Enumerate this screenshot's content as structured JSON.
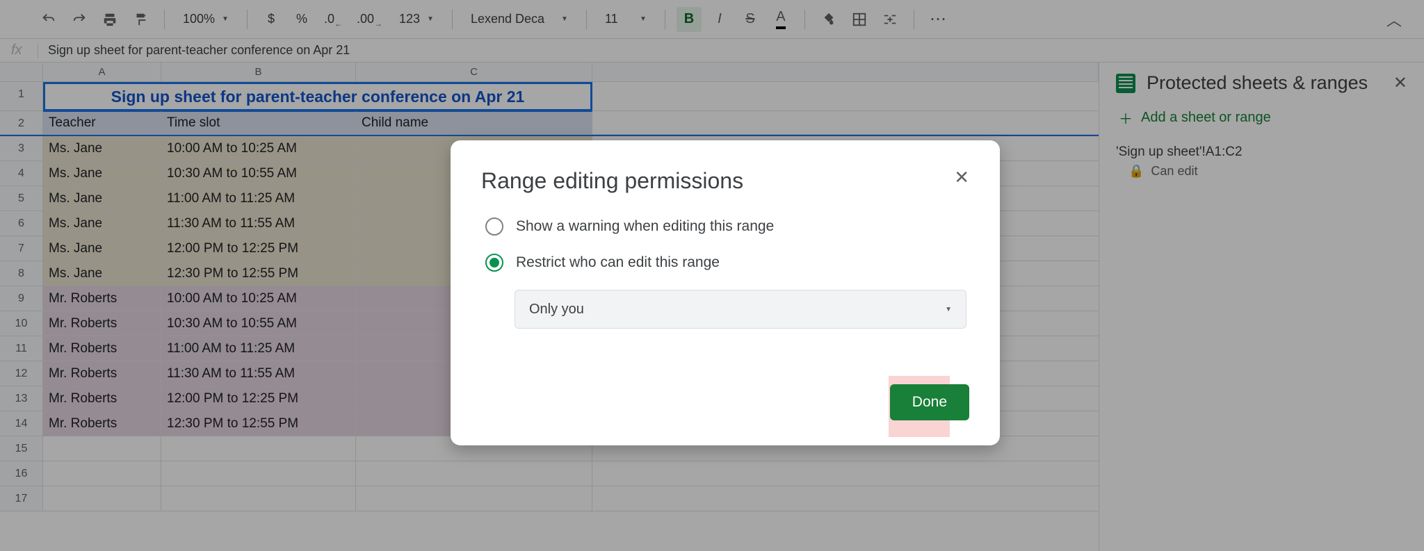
{
  "toolbar": {
    "zoom": "100%",
    "currency": "$",
    "percent": "%",
    "dec_dec": ".0",
    "dec_inc": ".00",
    "fmt123": "123",
    "font": "Lexend Deca",
    "font_size": "11",
    "bold": "B",
    "italic": "I",
    "strike": "S",
    "textcolor": "A",
    "more": "⋯"
  },
  "formula": {
    "label": "fx",
    "value": "Sign up sheet for parent-teacher conference on Apr 21"
  },
  "cols": [
    "A",
    "B",
    "C"
  ],
  "rows": {
    "title": "Sign up sheet for parent-teacher conference on Apr 21",
    "headers": {
      "a": "Teacher",
      "b": "Time slot",
      "c": "Child name"
    },
    "data": [
      {
        "n": "3",
        "a": "Ms. Jane",
        "b": "10:00 AM to 10:25 AM",
        "cls": "jane"
      },
      {
        "n": "4",
        "a": "Ms. Jane",
        "b": "10:30 AM to 10:55 AM",
        "cls": "jane"
      },
      {
        "n": "5",
        "a": "Ms. Jane",
        "b": "11:00 AM to 11:25 AM",
        "cls": "jane"
      },
      {
        "n": "6",
        "a": "Ms. Jane",
        "b": "11:30 AM to 11:55 AM",
        "cls": "jane"
      },
      {
        "n": "7",
        "a": "Ms. Jane",
        "b": "12:00 PM to 12:25 PM",
        "cls": "jane"
      },
      {
        "n": "8",
        "a": "Ms. Jane",
        "b": "12:30 PM to 12:55 PM",
        "cls": "jane"
      },
      {
        "n": "9",
        "a": "Mr. Roberts",
        "b": "10:00 AM to 10:25 AM",
        "cls": "roberts"
      },
      {
        "n": "10",
        "a": "Mr. Roberts",
        "b": "10:30 AM to 10:55 AM",
        "cls": "roberts"
      },
      {
        "n": "11",
        "a": "Mr. Roberts",
        "b": "11:00 AM to 11:25 AM",
        "cls": "roberts"
      },
      {
        "n": "12",
        "a": "Mr. Roberts",
        "b": "11:30 AM to 11:55 AM",
        "cls": "roberts"
      },
      {
        "n": "13",
        "a": "Mr. Roberts",
        "b": "12:00 PM to 12:25 PM",
        "cls": "roberts"
      },
      {
        "n": "14",
        "a": "Mr. Roberts",
        "b": "12:30 PM to 12:55 PM",
        "cls": "roberts"
      }
    ],
    "empty": [
      "15",
      "16",
      "17"
    ]
  },
  "side": {
    "title": "Protected sheets & ranges",
    "add": "Add a sheet or range",
    "range": "'Sign up sheet'!A1:C2",
    "perm": "Can edit"
  },
  "dialog": {
    "title": "Range editing permissions",
    "opt_warn": "Show a warning when editing this range",
    "opt_restrict": "Restrict who can edit this range",
    "dropdown": "Only you",
    "done": "Done"
  }
}
